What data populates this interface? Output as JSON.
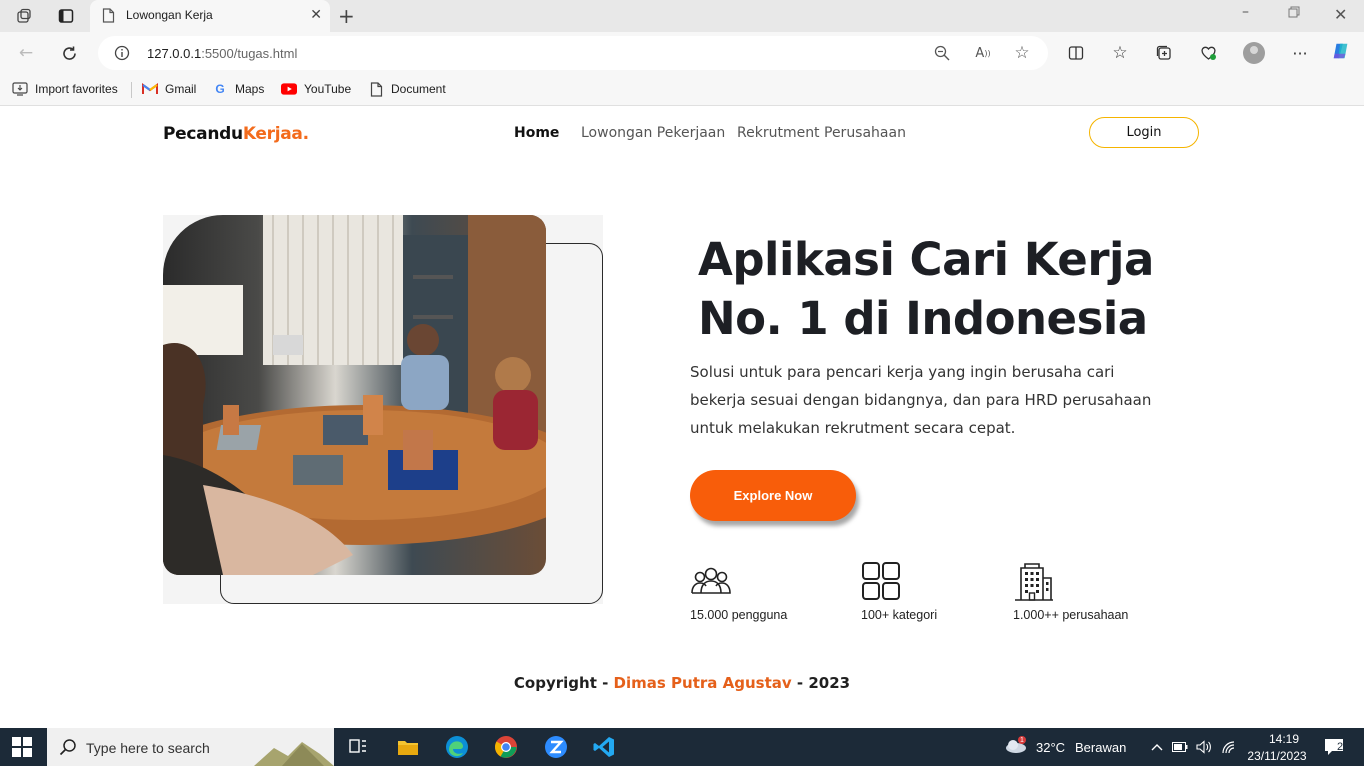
{
  "browser": {
    "tab_title": "Lowongan Kerja",
    "url_host": "127.0.0.1",
    "url_path": ":5500/tugas.html",
    "favorites": [
      {
        "label": "Import favorites"
      },
      {
        "label": "Gmail"
      },
      {
        "label": "Maps"
      },
      {
        "label": "YouTube"
      },
      {
        "label": "Document"
      }
    ]
  },
  "site": {
    "logo_main": "Pecandu",
    "logo_accent": "Kerjaa.",
    "nav": [
      {
        "label": "Home"
      },
      {
        "label": "Lowongan Pekerjaan"
      },
      {
        "label": "Rekrutment Perusahaan"
      }
    ],
    "login_label": "Login"
  },
  "hero": {
    "headline_line1": "Aplikasi Cari Kerja",
    "headline_line2": "No. 1 di Indonesia",
    "subtext": "Solusi untuk para pencari kerja yang ingin berusaha cari bekerja sesuai dengan bidangnya, dan para HRD perusahaan untuk melakukan rekrutment secara cepat.",
    "cta_label": "Explore Now",
    "stats": [
      {
        "icon": "users-icon",
        "label": "15.000 pengguna"
      },
      {
        "icon": "grid-icon",
        "label": "100+ kategori"
      },
      {
        "icon": "building-icon",
        "label": "1.000++ perusahaan"
      }
    ]
  },
  "footer": {
    "prefix": "Copyright - ",
    "name": "Dimas Putra Agustav",
    "suffix": " - 2023"
  },
  "taskbar": {
    "search_placeholder": "Type here to search",
    "weather_temp": "32°C",
    "weather_desc": "Berawan",
    "weather_badge": "1",
    "time": "14:19",
    "date": "23/11/2023",
    "notification_count": "2"
  },
  "colors": {
    "accent": "#f36b1c",
    "cta": "#f85d0a",
    "login_border": "#f5b400",
    "taskbar": "#1c2a38"
  }
}
